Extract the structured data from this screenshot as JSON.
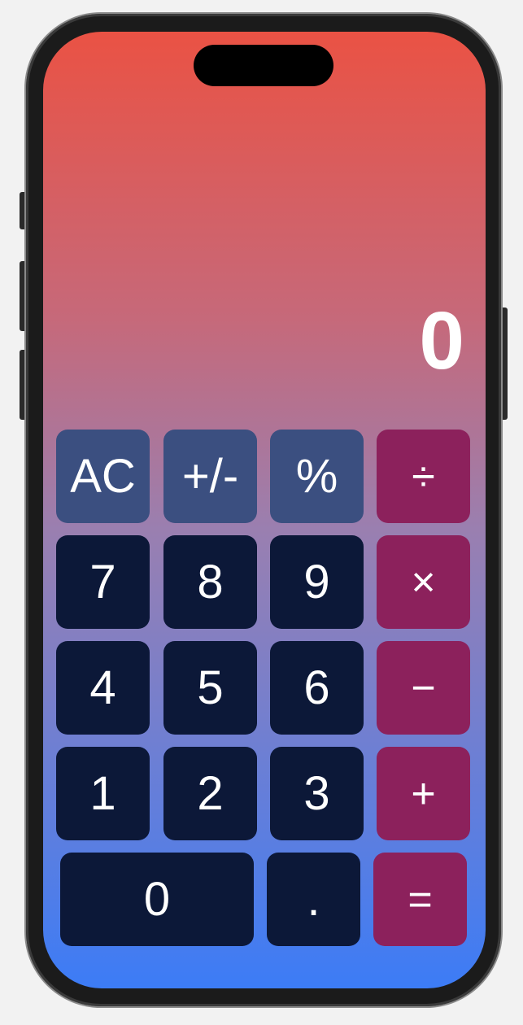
{
  "display": {
    "value": "0"
  },
  "keys": {
    "row1": [
      "AC",
      "+/-",
      "%",
      "÷"
    ],
    "row2": [
      "7",
      "8",
      "9",
      "×"
    ],
    "row3": [
      "4",
      "5",
      "6",
      "−"
    ],
    "row4": [
      "1",
      "2",
      "3",
      "+"
    ],
    "row5": [
      "0",
      ".",
      "="
    ]
  },
  "colors": {
    "function_key": "#3b4f80",
    "number_key": "#0c1838",
    "operator_key": "#8c215c",
    "gradient_top": "#ea5244",
    "gradient_bottom": "#3c7cf6"
  }
}
